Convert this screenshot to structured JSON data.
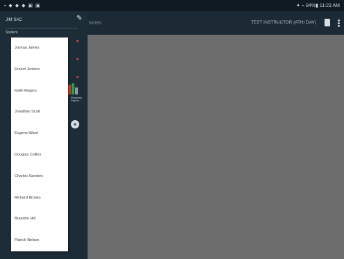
{
  "status_bar": {
    "left_icons": "▪ ◆ ◆ ◆ ▣ ▣",
    "right_text": "✦ ⌁ 84%▮ 11:23 AM"
  },
  "action_bar": {
    "title": "Notes",
    "right_label": "TEST INSTRUCTOR (ATHI DAV)",
    "doc_icon": "document-icon",
    "overflow_icon": "more-vert-icon"
  },
  "drawer": {
    "user_name": "JIM SAC",
    "section_label": "Student",
    "chart_caption": "Progress Report",
    "chart_colors": [
      "#d33a2c",
      "#2f9e44",
      "#8b9aa6"
    ],
    "edit_icon": "edit-icon",
    "add_icon": "add-circle-icon"
  },
  "student_list": {
    "items": [
      "Joshua James",
      "Ernest Jenkins",
      "Keith Rogers",
      "Jonathan Scott",
      "Eugene Ward",
      "Douglas Collins",
      "Charles Sanders",
      "Richard Brooks",
      "Brandon Hill",
      "Patrick Nelson"
    ]
  }
}
